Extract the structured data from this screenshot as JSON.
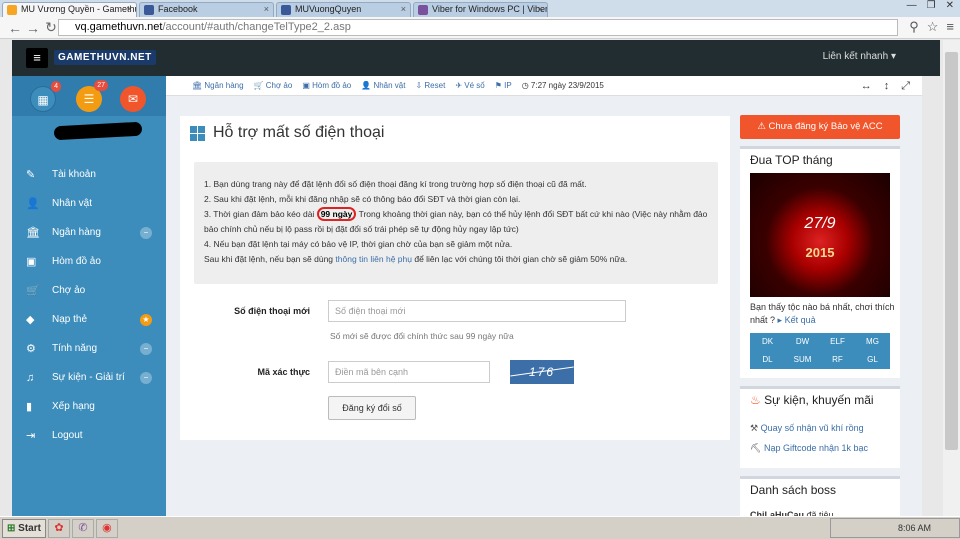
{
  "browser": {
    "tabs": [
      {
        "label": "MU Vương Quyền - Gamethu...",
        "color": "#f6a623"
      },
      {
        "label": "Facebook",
        "color": "#3b5998"
      },
      {
        "label": "MUVuongQuyen",
        "color": "#3b5998"
      },
      {
        "label": "Viber for Windows PC | Viber",
        "color": "#7b519d"
      }
    ],
    "url_host": "vq.gamethuvn.net",
    "url_path": "/account/#auth/changeTelType2_2.asp"
  },
  "topbar": {
    "logo": "GAMETHUVN.NET",
    "lienket": "Liên kết nhanh"
  },
  "sidebar": {
    "badges": [
      "4",
      "27"
    ],
    "items": [
      {
        "label": "Tài khoản",
        "icon": "✎"
      },
      {
        "label": "Nhân vật",
        "icon": "👤"
      },
      {
        "label": "Ngân hàng",
        "icon": "🏛",
        "pill": "−"
      },
      {
        "label": "Hòm đồ ảo",
        "icon": "▣"
      },
      {
        "label": "Chợ ảo",
        "icon": "🛒"
      },
      {
        "label": "Nạp thẻ",
        "icon": "◆",
        "pill": "★"
      },
      {
        "label": "Tính năng",
        "icon": "⚙",
        "pill": "−"
      },
      {
        "label": "Sự kiện - Giải trí",
        "icon": "♫",
        "pill": "−"
      },
      {
        "label": "Xếp hạng",
        "icon": "▮"
      },
      {
        "label": "Logout",
        "icon": "⇥"
      }
    ]
  },
  "breadcrumb": {
    "items": [
      "Ngân hàng",
      "Chợ ảo",
      "Hòm đồ ảo",
      "Nhân vật",
      "Reset",
      "Vé số",
      "IP"
    ],
    "time": "7:27 ngày 23/9/2015"
  },
  "content": {
    "title": "Hỗ trợ mất số điện thoại",
    "note": {
      "l1": "1. Bạn dùng trang này để đặt lệnh đổi số điện thoại đăng kí trong trường hợp số điện thoại cũ đã mất.",
      "l2": "2. Sau khi đặt lệnh, mỗi khi đăng nhập sẽ có thông báo đổi SĐT và thời gian còn lại.",
      "l3a": "3. Thời gian đảm bảo kéo dài",
      "l3hl": "99 ngày",
      "l3b": "Trong khoảng thời gian này, bạn có thể hủy lệnh đổi SĐT bất cứ khi nào (Việc này nhằm đảo bảo chính chủ nếu bị lộ pass rồi bị đặt đổi số trái phép sẽ tự động hủy ngay lập tức)",
      "l4": "4. Nếu bạn đặt lệnh tại máy có bảo vệ IP, thời gian chờ của bạn sẽ giảm một nửa.",
      "l5a": "Sau khi đặt lệnh, nếu bạn sẽ dùng",
      "l5link": "thông tin liên hệ phụ",
      "l5b": "để liên lạc với chúng tôi thời gian chờ sẽ giảm 50% nữa."
    },
    "phone_label": "Số điện thoại mới",
    "phone_placeholder": "Số điện thoại mới",
    "phone_help": "Số mới sẽ được đổi chính thức sau 99 ngày nữa",
    "captcha_label": "Mã xác thực",
    "captcha_placeholder": "Điền mã bên cạnh",
    "captcha_code": "176",
    "submit": "Đăng ký đổi số"
  },
  "right": {
    "warn": "Chưa đăng ký Bảo vệ ACC",
    "top_title": "Đua TOP tháng",
    "top_date": "27/9",
    "top_year": "2015",
    "top_text": "Bạn thấy tộc nào bá nhất, chơi thích nhất ?",
    "top_link": "Kết quả",
    "grid": [
      "DK",
      "DW",
      "ELF",
      "MG",
      "DL",
      "SUM",
      "RF",
      "GL"
    ],
    "events_title": "Sự kiện, khuyến mãi",
    "events": [
      "Quay số nhận vũ khí rồng",
      "Nạp Giftcode nhận 1k bạc"
    ],
    "boss_title": "Danh sách boss",
    "boss_item": "ChiLaHuCau",
    "boss_suffix": "đã tiêu"
  },
  "taskbar": {
    "start": "Start",
    "clock": "8:06 AM"
  }
}
